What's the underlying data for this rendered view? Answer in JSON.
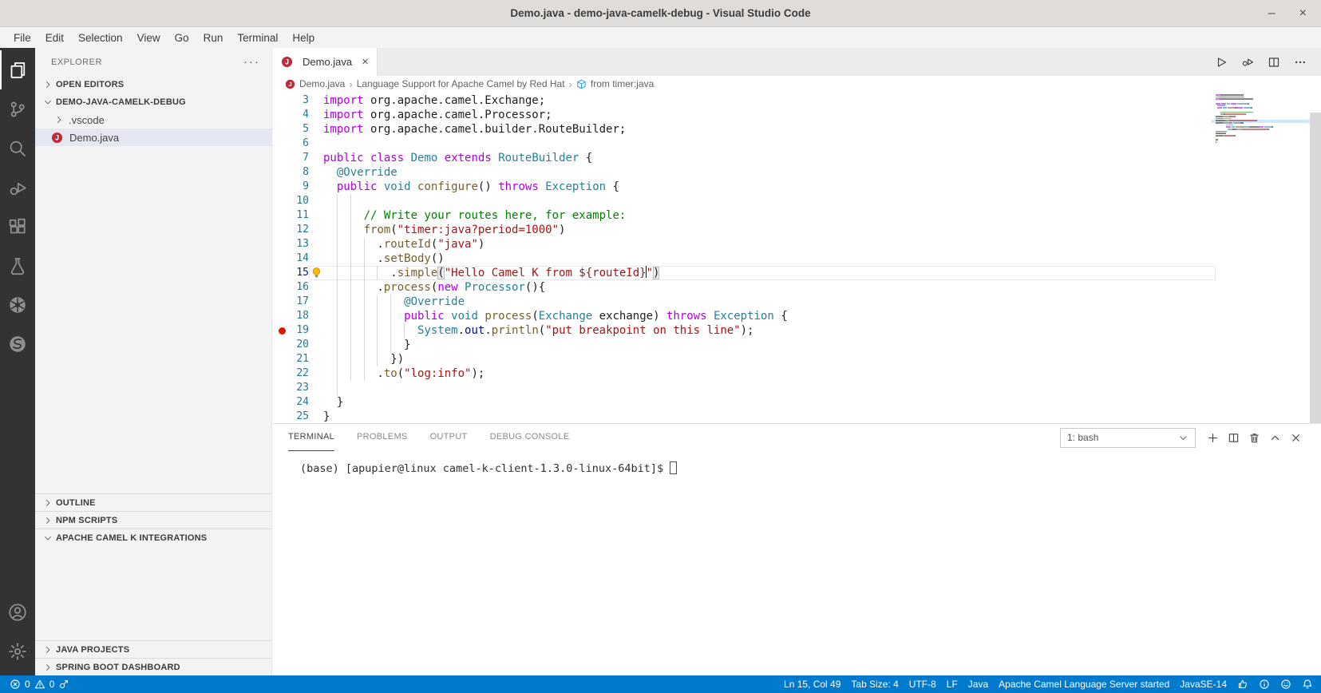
{
  "window": {
    "title": "Demo.java - demo-java-camelk-debug - Visual Studio Code",
    "controls": {
      "minimize": "–",
      "close": "×"
    }
  },
  "menu": {
    "items": [
      "File",
      "Edit",
      "Selection",
      "View",
      "Go",
      "Run",
      "Terminal",
      "Help"
    ]
  },
  "activity_bar": {
    "top": [
      {
        "icon": "files-icon",
        "active": true
      },
      {
        "icon": "source-control-icon"
      },
      {
        "icon": "search-icon"
      },
      {
        "icon": "run-debug-icon"
      },
      {
        "icon": "extensions-icon"
      },
      {
        "icon": "test-flask-icon"
      },
      {
        "icon": "kubernetes-icon"
      },
      {
        "icon": "spring-icon"
      }
    ],
    "bottom": [
      {
        "icon": "account-icon"
      },
      {
        "icon": "settings-gear-icon"
      }
    ]
  },
  "sidebar": {
    "header": {
      "title": "EXPLORER",
      "actions": "···"
    },
    "open_editors": {
      "label": "OPEN EDITORS"
    },
    "workspace": {
      "label": "DEMO-JAVA-CAMELK-DEBUG"
    },
    "tree": [
      {
        "label": ".vscode"
      },
      {
        "label": "Demo.java"
      }
    ],
    "panes": {
      "outline": "OUTLINE",
      "npm_scripts": "NPM SCRIPTS",
      "camel_k": "APACHE CAMEL K INTEGRATIONS",
      "java_projects": "JAVA PROJECTS",
      "spring_boot": "SPRING BOOT DASHBOARD"
    }
  },
  "editor": {
    "tab": {
      "label": "Demo.java",
      "close": "×"
    },
    "actions": [
      "run-icon",
      "run-or-debug-icon",
      "split-editor-icon",
      "more-actions-icon"
    ],
    "breadcrumb": {
      "file": "Demo.java",
      "extension": "Language Support for Apache Camel by Red Hat",
      "symbol": "from timer:java",
      "separator": "›"
    },
    "code": {
      "lines": [
        {
          "n": 3,
          "seg": [
            [
              "k",
              "import"
            ],
            [
              "p",
              " org.apache.camel.Exchange;"
            ]
          ]
        },
        {
          "n": 4,
          "seg": [
            [
              "k",
              "import"
            ],
            [
              "p",
              " org.apache.camel.Processor;"
            ]
          ]
        },
        {
          "n": 5,
          "seg": [
            [
              "k",
              "import"
            ],
            [
              "p",
              " org.apache.camel.builder.RouteBuilder;"
            ]
          ]
        },
        {
          "n": 6,
          "seg": []
        },
        {
          "n": 7,
          "seg": [
            [
              "k",
              "public"
            ],
            [
              "p",
              " "
            ],
            [
              "k",
              "class"
            ],
            [
              "p",
              " "
            ],
            [
              "t",
              "Demo"
            ],
            [
              "p",
              " "
            ],
            [
              "k",
              "extends"
            ],
            [
              "p",
              " "
            ],
            [
              "t",
              "RouteBuilder"
            ],
            [
              "p",
              " {"
            ]
          ]
        },
        {
          "n": 8,
          "seg": [
            [
              "p",
              "  "
            ],
            [
              "t",
              "@Override"
            ]
          ]
        },
        {
          "n": 9,
          "seg": [
            [
              "p",
              "  "
            ],
            [
              "k",
              "public"
            ],
            [
              "p",
              " "
            ],
            [
              "t",
              "void"
            ],
            [
              "p",
              " "
            ],
            [
              "f",
              "configure"
            ],
            [
              "p",
              "() "
            ],
            [
              "k",
              "throws"
            ],
            [
              "p",
              " "
            ],
            [
              "t",
              "Exception"
            ],
            [
              "p",
              " {"
            ]
          ]
        },
        {
          "n": 10,
          "seg": [],
          "g": [
            2,
            4
          ]
        },
        {
          "n": 11,
          "seg": [
            [
              "p",
              "      "
            ],
            [
              "c",
              "// Write your routes here, for example:"
            ]
          ],
          "g": [
            2,
            4
          ]
        },
        {
          "n": 12,
          "seg": [
            [
              "p",
              "      "
            ],
            [
              "f",
              "from"
            ],
            [
              "p",
              "("
            ],
            [
              "s",
              "\"timer:java?period=1000\""
            ],
            [
              "p",
              ")"
            ]
          ],
          "g": [
            2,
            4
          ]
        },
        {
          "n": 13,
          "seg": [
            [
              "p",
              "        ."
            ],
            [
              "f",
              "routeId"
            ],
            [
              "p",
              "("
            ],
            [
              "s",
              "\"java\""
            ],
            [
              "p",
              ")"
            ]
          ],
          "g": [
            2,
            4,
            6
          ]
        },
        {
          "n": 14,
          "seg": [
            [
              "p",
              "        ."
            ],
            [
              "f",
              "setBody"
            ],
            [
              "p",
              "()"
            ]
          ],
          "g": [
            2,
            4,
            6
          ]
        },
        {
          "n": 15,
          "current": true,
          "lightbulb": true,
          "seg": [
            [
              "p",
              "          ."
            ],
            [
              "f",
              "simple"
            ],
            [
              "bm",
              "("
            ],
            [
              "s",
              "\"Hello Camel K from ${routeId}"
            ],
            [
              "cur",
              ""
            ],
            [
              "s",
              "\""
            ],
            [
              "bm",
              ")"
            ]
          ],
          "g": [
            2,
            4,
            6,
            8
          ]
        },
        {
          "n": 16,
          "seg": [
            [
              "p",
              "        ."
            ],
            [
              "f",
              "process"
            ],
            [
              "p",
              "("
            ],
            [
              "k",
              "new"
            ],
            [
              "p",
              " "
            ],
            [
              "t",
              "Processor"
            ],
            [
              "p",
              "(){"
            ]
          ],
          "g": [
            2,
            4,
            6
          ]
        },
        {
          "n": 17,
          "seg": [
            [
              "p",
              "            "
            ],
            [
              "t",
              "@Override"
            ]
          ],
          "g": [
            2,
            4,
            6,
            8,
            10
          ]
        },
        {
          "n": 18,
          "seg": [
            [
              "p",
              "            "
            ],
            [
              "k",
              "public"
            ],
            [
              "p",
              " "
            ],
            [
              "t",
              "void"
            ],
            [
              "p",
              " "
            ],
            [
              "f",
              "process"
            ],
            [
              "p",
              "("
            ],
            [
              "t",
              "Exchange"
            ],
            [
              "p",
              " exchange) "
            ],
            [
              "k",
              "throws"
            ],
            [
              "p",
              " "
            ],
            [
              "t",
              "Exception"
            ],
            [
              "p",
              " {"
            ]
          ],
          "g": [
            2,
            4,
            6,
            8,
            10
          ]
        },
        {
          "n": 19,
          "breakpoint": true,
          "seg": [
            [
              "p",
              "              "
            ],
            [
              "t",
              "System"
            ],
            [
              "p",
              "."
            ],
            [
              "v",
              "out"
            ],
            [
              "p",
              "."
            ],
            [
              "f",
              "println"
            ],
            [
              "p",
              "("
            ],
            [
              "s",
              "\"put breakpoint on this line\""
            ],
            [
              "p",
              ");"
            ]
          ],
          "g": [
            2,
            4,
            6,
            8,
            10,
            12
          ]
        },
        {
          "n": 20,
          "seg": [
            [
              "p",
              "            }"
            ]
          ],
          "g": [
            2,
            4,
            6,
            8,
            10
          ]
        },
        {
          "n": 21,
          "seg": [
            [
              "p",
              "          })"
            ]
          ],
          "g": [
            2,
            4,
            6,
            8
          ]
        },
        {
          "n": 22,
          "seg": [
            [
              "p",
              "        ."
            ],
            [
              "f",
              "to"
            ],
            [
              "p",
              "("
            ],
            [
              "s",
              "\"log:info\""
            ],
            [
              "p",
              ");"
            ]
          ],
          "g": [
            2,
            4,
            6
          ]
        },
        {
          "n": 23,
          "seg": [],
          "g": [
            2
          ]
        },
        {
          "n": 24,
          "seg": [
            [
              "p",
              "  }"
            ]
          ]
        },
        {
          "n": 25,
          "seg": [
            [
              "p",
              "}"
            ]
          ]
        }
      ]
    }
  },
  "panel": {
    "tabs": [
      {
        "label": "TERMINAL",
        "active": true
      },
      {
        "label": "PROBLEMS"
      },
      {
        "label": "OUTPUT"
      },
      {
        "label": "DEBUG CONSOLE"
      }
    ],
    "shell_selector": {
      "value": "1: bash"
    },
    "actions": [
      "new-terminal-icon",
      "split-terminal-icon",
      "kill-terminal-icon",
      "maximize-panel-icon",
      "close-panel-icon"
    ],
    "terminal": {
      "prompt": "(base) [apupier@linux camel-k-client-1.3.0-linux-64bit]$"
    }
  },
  "status_bar": {
    "left": [
      {
        "icon": "error-icon"
      },
      {
        "text": "0"
      },
      {
        "icon": "warning-icon"
      },
      {
        "text": "0"
      },
      {
        "icon": "camel-debug-icon"
      }
    ],
    "right": [
      {
        "text": "Ln 15, Col 49"
      },
      {
        "text": "Tab Size: 4"
      },
      {
        "text": "UTF-8"
      },
      {
        "text": "LF"
      },
      {
        "text": "Java"
      },
      {
        "text": "Apache Camel Language Server started"
      },
      {
        "text": "JavaSE-14"
      },
      {
        "icon": "thumbsup-icon"
      },
      {
        "icon": "info-icon"
      },
      {
        "icon": "feedback-icon"
      },
      {
        "icon": "bell-icon"
      }
    ]
  },
  "syntax": {
    "k": "#AF00DB",
    "t": "#267F99",
    "f": "#795E26",
    "s": "#A31515",
    "c": "#008000",
    "v": "#001080",
    "p": "#1E1E1E"
  },
  "colors": {
    "status_bar_bg": "#007ACC",
    "activity_bar_bg": "#333333",
    "sidebar_bg": "#F3F3F3",
    "list_selection_bg": "#E4E6F1",
    "java_icon_red": "#BF2B3A",
    "breakpoint_red": "#E51400",
    "lightbulb_yellow": "#FFB900",
    "breadcrumb_symbol_blue": "#1F9CF0"
  }
}
